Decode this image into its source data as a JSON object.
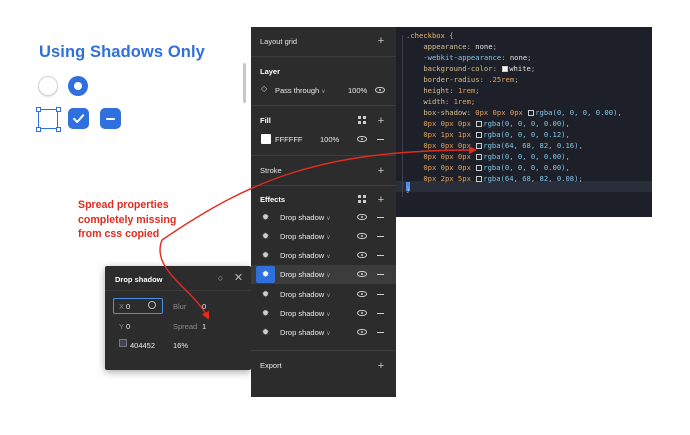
{
  "demo": {
    "title": "Using Shadows Only",
    "annotation_lines": [
      "Spread properties",
      "completely missing",
      "from css copied"
    ],
    "accent_color": "#2f6fde",
    "annotation_color": "#e12b1f"
  },
  "popover": {
    "title": "Drop shadow",
    "x_label": "X",
    "x_value": "0",
    "y_label": "Y",
    "y_value": "0",
    "blur_label": "Blur",
    "blur_value": "0",
    "spread_label": "Spread",
    "spread_value": "1",
    "color_hex": "404452",
    "opacity": "16%"
  },
  "panel": {
    "layout_grid": "Layout grid",
    "layer_title": "Layer",
    "blend_mode": "Pass through",
    "layer_opacity": "100%",
    "fill_title": "Fill",
    "fill_hex": "FFFFFF",
    "fill_opacity": "100%",
    "stroke_title": "Stroke",
    "effects_title": "Effects",
    "effects": [
      {
        "label": "Drop shadow"
      },
      {
        "label": "Drop shadow"
      },
      {
        "label": "Drop shadow"
      },
      {
        "label": "Drop shadow"
      },
      {
        "label": "Drop shadow"
      },
      {
        "label": "Drop shadow"
      },
      {
        "label": "Drop shadow"
      }
    ],
    "export_title": "Export"
  },
  "code": {
    "selector": ".checkbox",
    "open_brace": "{",
    "close_brace": "}",
    "appearance": "none",
    "webkit_appearance": "none",
    "background_color": "white",
    "border_radius": ".25rem",
    "height": "1rem",
    "width": "1rem",
    "shadows": [
      {
        "offsets": "0px 0px 0px",
        "rgba": "rgba(0, 0, 0, 0.00)",
        "end": ","
      },
      {
        "offsets": "0px 0px 0px",
        "rgba": "rgba(0, 0, 0, 0.00)",
        "end": ","
      },
      {
        "offsets": "0px 1px 1px",
        "rgba": "rgba(0, 0, 0, 0.12)",
        "end": ","
      },
      {
        "offsets": "0px 0px 0px",
        "rgba": "rgba(64, 68, 82, 0.16)",
        "end": ","
      },
      {
        "offsets": "0px 0px 0px",
        "rgba": "rgba(0, 0, 0, 0.00)",
        "end": ","
      },
      {
        "offsets": "0px 0px 0px",
        "rgba": "rgba(0, 0, 0, 0.00)",
        "end": ","
      },
      {
        "offsets": "0px 2px 5px",
        "rgba": "rgba(64, 68, 82, 0.08)",
        "end": ";"
      }
    ]
  }
}
